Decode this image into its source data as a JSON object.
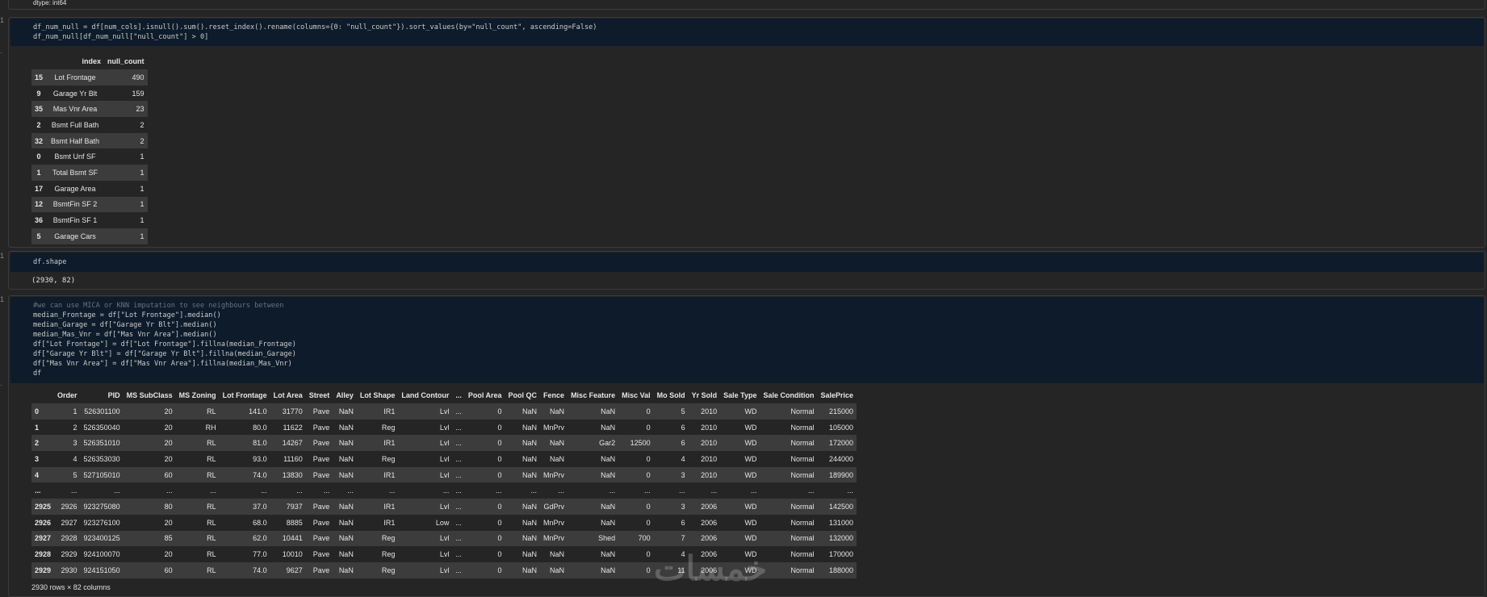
{
  "top_text": "dtype: int64",
  "cell1": {
    "code_lines": [
      "df_num_null = df[num_cols].isnull().sum().reset_index().rename(columns={0: \"null_count\"}).sort_values(by=\"null_count\", ascending=False)",
      "df_num_null[df_num_null[\"null_count\"] > 0]"
    ],
    "table": {
      "columns": [
        "index",
        "null_count"
      ],
      "rows": [
        [
          "15",
          "Lot Frontage",
          "490"
        ],
        [
          "9",
          "Garage Yr Blt",
          "159"
        ],
        [
          "35",
          "Mas Vnr Area",
          "23"
        ],
        [
          "2",
          "Bsmt Full Bath",
          "2"
        ],
        [
          "32",
          "Bsmt Half Bath",
          "2"
        ],
        [
          "0",
          "Bsmt Unf SF",
          "1"
        ],
        [
          "1",
          "Total Bsmt SF",
          "1"
        ],
        [
          "17",
          "Garage Area",
          "1"
        ],
        [
          "12",
          "BsmtFin SF 2",
          "1"
        ],
        [
          "36",
          "BsmtFin SF 1",
          "1"
        ],
        [
          "5",
          "Garage Cars",
          "1"
        ]
      ]
    }
  },
  "cell2": {
    "code_lines": [
      "df.shape"
    ],
    "output": "(2930, 82)"
  },
  "cell3": {
    "code_lines": [
      "#we can use MICA or KNN imputation to see neighbours between",
      "median_Frontage = df[\"Lot Frontage\"].median()",
      "median_Garage = df[\"Garage Yr Blt\"].median()",
      "median_Mas_Vnr = df[\"Mas Vnr Area\"].median()",
      "df[\"Lot Frontage\"] = df[\"Lot Frontage\"].fillna(median_Frontage)",
      "df[\"Garage Yr Blt\"] = df[\"Garage Yr Blt\"].fillna(median_Garage)",
      "df[\"Mas Vnr Area\"] = df[\"Mas Vnr Area\"].fillna(median_Mas_Vnr)",
      "df"
    ],
    "table": {
      "columns": [
        "",
        "Order",
        "PID",
        "MS SubClass",
        "MS Zoning",
        "Lot Frontage",
        "Lot Area",
        "Street",
        "Alley",
        "Lot Shape",
        "Land Contour",
        "...",
        "Pool Area",
        "Pool QC",
        "Fence",
        "Misc Feature",
        "Misc Val",
        "Mo Sold",
        "Yr Sold",
        "Sale Type",
        "Sale Condition",
        "SalePrice"
      ],
      "rows": [
        [
          "0",
          "1",
          "526301100",
          "20",
          "RL",
          "141.0",
          "31770",
          "Pave",
          "NaN",
          "IR1",
          "Lvl",
          "...",
          "0",
          "NaN",
          "NaN",
          "NaN",
          "0",
          "5",
          "2010",
          "WD",
          "Normal",
          "215000"
        ],
        [
          "1",
          "2",
          "526350040",
          "20",
          "RH",
          "80.0",
          "11622",
          "Pave",
          "NaN",
          "Reg",
          "Lvl",
          "...",
          "0",
          "NaN",
          "MnPrv",
          "NaN",
          "0",
          "6",
          "2010",
          "WD",
          "Normal",
          "105000"
        ],
        [
          "2",
          "3",
          "526351010",
          "20",
          "RL",
          "81.0",
          "14267",
          "Pave",
          "NaN",
          "IR1",
          "Lvl",
          "...",
          "0",
          "NaN",
          "NaN",
          "Gar2",
          "12500",
          "6",
          "2010",
          "WD",
          "Normal",
          "172000"
        ],
        [
          "3",
          "4",
          "526353030",
          "20",
          "RL",
          "93.0",
          "11160",
          "Pave",
          "NaN",
          "Reg",
          "Lvl",
          "...",
          "0",
          "NaN",
          "NaN",
          "NaN",
          "0",
          "4",
          "2010",
          "WD",
          "Normal",
          "244000"
        ],
        [
          "4",
          "5",
          "527105010",
          "60",
          "RL",
          "74.0",
          "13830",
          "Pave",
          "NaN",
          "IR1",
          "Lvl",
          "...",
          "0",
          "NaN",
          "MnPrv",
          "NaN",
          "0",
          "3",
          "2010",
          "WD",
          "Normal",
          "189900"
        ],
        [
          "...",
          "...",
          "...",
          "...",
          "...",
          "...",
          "...",
          "...",
          "...",
          "...",
          "...",
          "...",
          "...",
          "...",
          "...",
          "...",
          "...",
          "...",
          "...",
          "...",
          "...",
          "..."
        ],
        [
          "2925",
          "2926",
          "923275080",
          "80",
          "RL",
          "37.0",
          "7937",
          "Pave",
          "NaN",
          "IR1",
          "Lvl",
          "...",
          "0",
          "NaN",
          "GdPrv",
          "NaN",
          "0",
          "3",
          "2006",
          "WD",
          "Normal",
          "142500"
        ],
        [
          "2926",
          "2927",
          "923276100",
          "20",
          "RL",
          "68.0",
          "8885",
          "Pave",
          "NaN",
          "IR1",
          "Low",
          "...",
          "0",
          "NaN",
          "MnPrv",
          "NaN",
          "0",
          "6",
          "2006",
          "WD",
          "Normal",
          "131000"
        ],
        [
          "2927",
          "2928",
          "923400125",
          "85",
          "RL",
          "62.0",
          "10441",
          "Pave",
          "NaN",
          "Reg",
          "Lvl",
          "...",
          "0",
          "NaN",
          "MnPrv",
          "Shed",
          "700",
          "7",
          "2006",
          "WD",
          "Normal",
          "132000"
        ],
        [
          "2928",
          "2929",
          "924100070",
          "20",
          "RL",
          "77.0",
          "10010",
          "Pave",
          "NaN",
          "Reg",
          "Lvl",
          "...",
          "0",
          "NaN",
          "NaN",
          "NaN",
          "0",
          "4",
          "2006",
          "WD",
          "Normal",
          "170000"
        ],
        [
          "2929",
          "2930",
          "924151050",
          "60",
          "RL",
          "74.0",
          "9627",
          "Pave",
          "NaN",
          "Reg",
          "Lvl",
          "...",
          "0",
          "NaN",
          "NaN",
          "NaN",
          "0",
          "11",
          "2006",
          "WD",
          "Normal",
          "188000"
        ]
      ]
    },
    "footer": "2930 rows × 82 columns"
  },
  "watermark": "خمسات"
}
